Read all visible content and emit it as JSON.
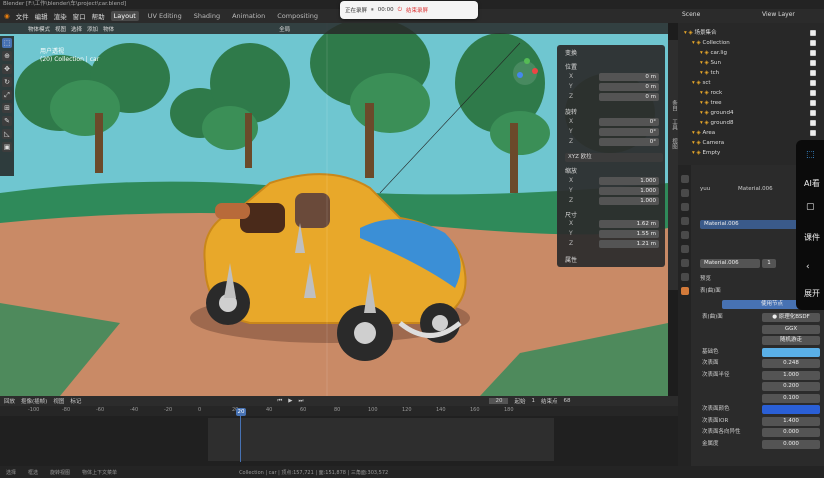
{
  "window": {
    "title": "Blender [F:\\工作\\blender\\车\\project\\car.blend]"
  },
  "menu": [
    "文件",
    "编辑",
    "渲染",
    "窗口",
    "帮助"
  ],
  "workspaces": [
    "Layout",
    "UV Editing",
    "Shading",
    "Animation",
    "Compositing"
  ],
  "active_workspace": "Layout",
  "recording": {
    "status": "正在录屏",
    "elapsed": "00:00",
    "stop": "结束录屏"
  },
  "viewport": {
    "header": [
      "物体模式",
      "视图",
      "选择",
      "添加",
      "物体",
      "全局"
    ],
    "info_line1": "用户透视",
    "info_line2": "(20) Collection | car"
  },
  "npanel": {
    "title": "变换",
    "location_label": "位置",
    "location": [
      "0 m",
      "0 m",
      "0 m"
    ],
    "rotation_label": "旋转",
    "rotation": [
      "0°",
      "0°",
      "0°"
    ],
    "rotation_mode": "XYZ 欧拉",
    "scale_label": "缩放",
    "scale": [
      "1.000",
      "1.000",
      "1.000"
    ],
    "dims_label": "尺寸",
    "dims": [
      "1.62 m",
      "1.55 m",
      "1.21 m"
    ],
    "axes": [
      "X",
      "Y",
      "Z"
    ],
    "props_label": "属性"
  },
  "sidetabs": [
    "条目",
    "工具",
    "视图"
  ],
  "timeline": {
    "header": [
      "回放",
      "抠像(插帧)",
      "视图",
      "标记"
    ],
    "current_frame": "20",
    "start": "起始",
    "start_val": "1",
    "end": "结束点",
    "end_val": "68",
    "ticks": [
      "-100",
      "-80",
      "-60",
      "-40",
      "-20",
      "0",
      "20",
      "40",
      "60",
      "80",
      "100",
      "120",
      "140",
      "160",
      "180"
    ]
  },
  "status": [
    "选择",
    "框选",
    "旋转视图",
    "物体上下文菜单",
    "Collection | car | 顶点:157,721 | 面:151,878 | 三角面:303,572"
  ],
  "outliner": {
    "scene": "Scene",
    "view_layer": "View Layer",
    "rows": [
      {
        "label": "场景集合",
        "indent": 0
      },
      {
        "label": "Collection",
        "indent": 1
      },
      {
        "label": "car.lig",
        "indent": 2
      },
      {
        "label": "Sun",
        "indent": 2
      },
      {
        "label": "tch",
        "indent": 2
      },
      {
        "label": "sct",
        "indent": 1
      },
      {
        "label": "rock",
        "indent": 2
      },
      {
        "label": "tree",
        "indent": 2
      },
      {
        "label": "ground4",
        "indent": 2
      },
      {
        "label": "ground8",
        "indent": 2
      },
      {
        "label": "Area",
        "indent": 1
      },
      {
        "label": "Camera",
        "indent": 1
      },
      {
        "label": "Empty",
        "indent": 1
      }
    ]
  },
  "properties": {
    "object": "yuu",
    "material_tab": "Material.006",
    "slot": "Material.006",
    "slot_users": "1",
    "sections": [
      "预览",
      "表(曲)面"
    ],
    "surface_button": "使用节点",
    "rows": [
      {
        "label": "表(曲)面",
        "value": "● 原理化BSDF"
      },
      {
        "label": "",
        "value": "GGX"
      },
      {
        "label": "",
        "value": "随机游走"
      },
      {
        "label": "基础色",
        "value": ""
      },
      {
        "label": "次表面",
        "value": "0.248"
      },
      {
        "label": "次表面半径",
        "value": "1.000"
      },
      {
        "label": "",
        "value": "0.200"
      },
      {
        "label": "",
        "value": "0.100"
      },
      {
        "label": "次表面颜色",
        "value": ""
      },
      {
        "label": "次表面IOR",
        "value": "1.400"
      },
      {
        "label": "次表面各向异性",
        "value": "0.000"
      },
      {
        "label": "金属度",
        "value": "0.000"
      }
    ]
  },
  "side_widget": {
    "label1": "AI看",
    "label2": "课件",
    "label3": "展开"
  },
  "colors": {
    "sky": "#6fc6d0",
    "ground": "#c98a66",
    "accent": "#4772b3",
    "car": "#e8a82a",
    "car_blue": "#3b8fd6"
  }
}
